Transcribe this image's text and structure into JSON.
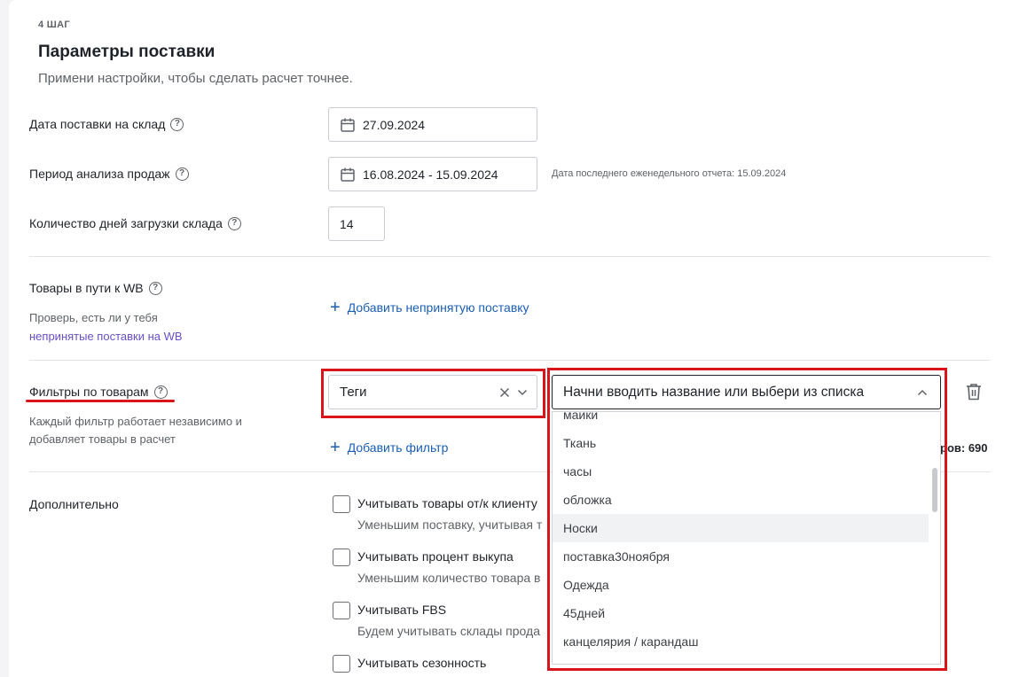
{
  "step": "4 ШАГ",
  "title": "Параметры поставки",
  "subtitle": "Примени настройки, чтобы сделать расчет точнее.",
  "delivery_date": {
    "label": "Дата поставки на склад",
    "value": "27.09.2024"
  },
  "analysis_period": {
    "label": "Период анализа продаж",
    "value": "16.08.2024 - 15.09.2024",
    "note": "Дата последнего еженедельного отчета: 15.09.2024"
  },
  "load_days": {
    "label": "Количество дней загрузки склада",
    "value": "14"
  },
  "in_transit": {
    "label": "Товары в пути к WB",
    "hint": "Проверь, есть ли у тебя",
    "hint_link": "непринятые поставки на WB",
    "add_label": "Добавить непринятую поставку"
  },
  "filters": {
    "label": "Фильтры по товарам",
    "description_line1": "Каждый фильтр работает независимо и",
    "description_line2": "добавляет товары в расчет",
    "type_value": "Теги",
    "search_placeholder": "Начни вводить название или выбери из списка",
    "add_label": "Добавить фильтр",
    "count_text": "ров: 690",
    "options": [
      "майки",
      "Ткань",
      "часы",
      "обложка",
      "Носки",
      "поставка30ноября",
      "Одежда",
      "45дней",
      "канцелярия / карандаш"
    ],
    "highlighted_option": "Носки"
  },
  "additional": {
    "label": "Дополнительно",
    "options": [
      {
        "label": "Учитывать товары от/к клиенту",
        "sub": "Уменьшим поставку, учитывая т"
      },
      {
        "label": "Учитывать процент выкупа",
        "sub": "Уменьшим количество товара в"
      },
      {
        "label": "Учитывать FBS",
        "sub": "Будем учитывать склады прода"
      },
      {
        "label": "Учитывать сезонность",
        "sub": ""
      }
    ]
  },
  "colors": {
    "accent": "#1a5fb4",
    "highlight_red": "#d9151c",
    "link_purple": "#6a4fc8"
  }
}
